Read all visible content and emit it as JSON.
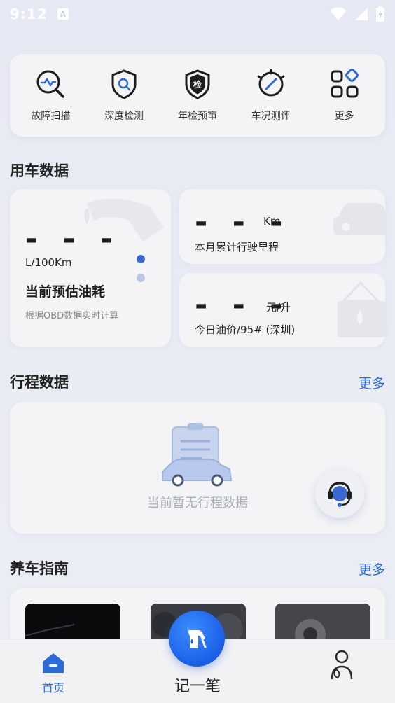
{
  "status_bar": {
    "time": "9:12",
    "notification_badge": "A"
  },
  "quick_actions": [
    {
      "label": "故障扫描",
      "icon": "scan-chart-icon"
    },
    {
      "label": "深度检测",
      "icon": "shield-search-icon"
    },
    {
      "label": "年检预审",
      "icon": "inspection-shield-icon",
      "icon_text": "检"
    },
    {
      "label": "车况测评",
      "icon": "gauge-icon"
    },
    {
      "label": "更多",
      "icon": "grid-more-icon"
    }
  ],
  "vehicle_data": {
    "section_title": "用车数据",
    "fuel": {
      "value": "- - -",
      "unit": "L/100Km",
      "title": "当前预估油耗",
      "subtitle": "根据OBD数据实时计算"
    },
    "mileage": {
      "value": "- - -",
      "unit": "Km",
      "label": "本月累计行驶里程"
    },
    "fuel_price": {
      "value": "- - -",
      "unit": "元/升",
      "label": "今日油价/95# (深圳)"
    }
  },
  "trip_data": {
    "section_title": "行程数据",
    "more_label": "更多",
    "empty_text": "当前暂无行程数据"
  },
  "guide": {
    "section_title": "养车指南",
    "more_label": "更多"
  },
  "tab_bar": {
    "home_label": "首页",
    "record_label": "记一笔"
  },
  "colors": {
    "accent": "#2f6bd6",
    "primary_button": "#1a5fe6",
    "background": "#e8eaf3",
    "card": "#f4f4f6"
  }
}
